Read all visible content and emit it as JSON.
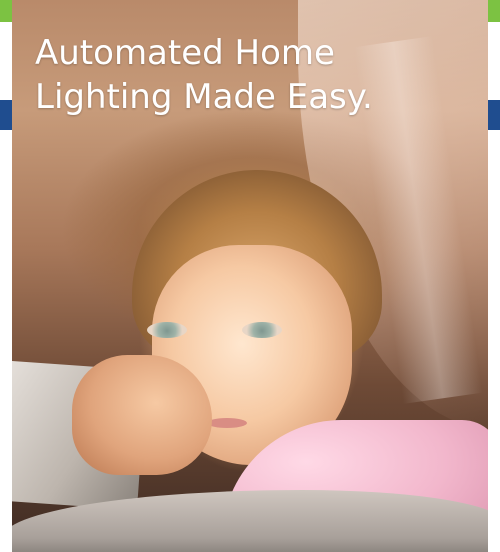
{
  "headline": {
    "line1": "Automated Home",
    "line2": "Lighting Made Easy."
  },
  "colors": {
    "accent_green": "#7cc242",
    "accent_blue": "#1f4d8f",
    "headline_text": "#ffffff"
  },
  "image": {
    "subject": "child-with-tablet-photo"
  }
}
